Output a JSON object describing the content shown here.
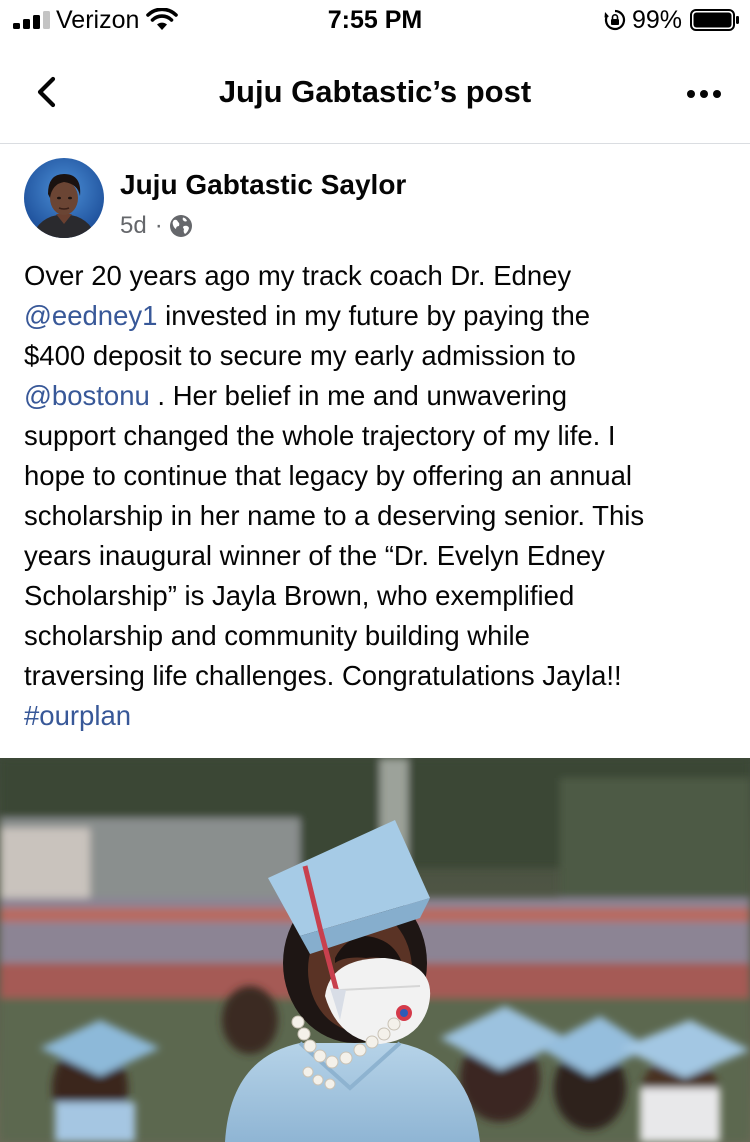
{
  "status_bar": {
    "carrier": "Verizon",
    "time": "7:55 PM",
    "battery_percent": "99%",
    "battery_level": 0.99
  },
  "header": {
    "title": "Juju Gabtastic’s post",
    "back_icon": "chevron-left-icon",
    "more_icon": "more-horizontal-icon"
  },
  "post": {
    "author": "Juju Gabtastic Saylor",
    "time": "5d",
    "separator": "·",
    "audience_icon": "globe-icon",
    "body_lines": [
      [
        "Over 20 years ago my track coach Dr. Edney"
      ],
      [
        "",
        "@eedney1",
        " invested in my future by paying the"
      ],
      [
        "$400 deposit to secure my early admission to"
      ],
      [
        "",
        "@bostonu",
        " . Her belief in me and unwavering"
      ],
      [
        "support changed the whole trajectory of my life. I"
      ],
      [
        "hope to continue that legacy by offering an annual"
      ],
      [
        "scholarship in her name to a deserving senior. This"
      ],
      [
        "years inaugural winner of the “Dr. Evelyn Edney"
      ],
      [
        "Scholarship” is Jayla Brown, who exemplified"
      ],
      [
        "scholarship and community building while"
      ],
      [
        "traversing life challenges. Congratulations Jayla!!"
      ],
      [
        "",
        "#ourplan"
      ]
    ],
    "link_color": "#385898"
  }
}
